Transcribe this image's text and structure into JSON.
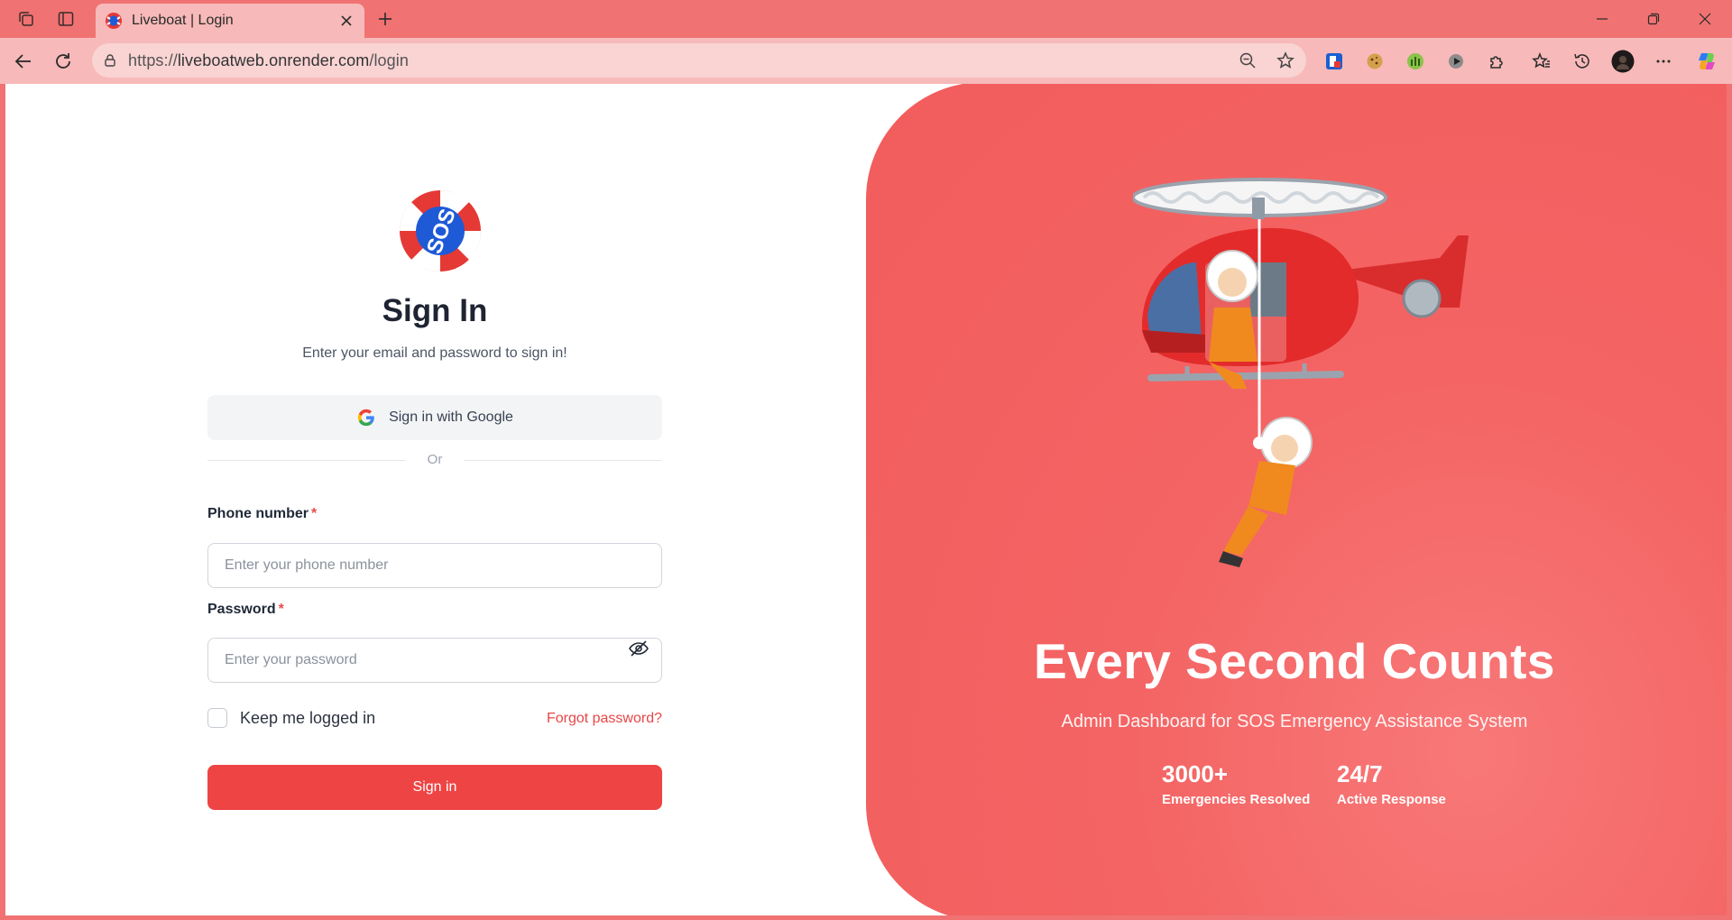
{
  "browser": {
    "tab_title": "Liveboat | Login",
    "url_scheme": "https://",
    "url_host": "liveboatweb.onrender.com",
    "url_path": "/login"
  },
  "login": {
    "title": "Sign In",
    "subtitle": "Enter your email and password to sign in!",
    "google_label": "Sign in with Google",
    "divider": "Or",
    "phone_label": "Phone number",
    "phone_placeholder": "Enter your phone number",
    "password_label": "Password",
    "password_placeholder": "Enter your password",
    "required_marker": "*",
    "keep_logged_in": "Keep me logged in",
    "forgot": "Forgot password?",
    "submit": "Sign in"
  },
  "logo": {
    "text": "SOS"
  },
  "hero": {
    "title": "Every Second Counts",
    "subtitle": "Admin Dashboard for SOS Emergency Assistance System",
    "stats": [
      {
        "value": "3000+",
        "label": "Emergencies Resolved"
      },
      {
        "value": "24/7",
        "label": "Active Response"
      }
    ]
  },
  "colors": {
    "accent": "#ef4444",
    "hero_bg": "#f46464",
    "chrome_bg": "#f07272"
  },
  "icons": [
    "workspaces-icon",
    "tab-actions-icon",
    "close-icon",
    "new-tab-icon",
    "minimize-icon",
    "restore-icon",
    "back-icon",
    "refresh-icon",
    "site-info-icon",
    "zoom-out-icon",
    "favorite-icon",
    "extensions-icon",
    "favorites-icon",
    "history-icon",
    "profile-avatar",
    "more-icon",
    "copilot-icon",
    "google-icon",
    "eye-off-icon"
  ]
}
